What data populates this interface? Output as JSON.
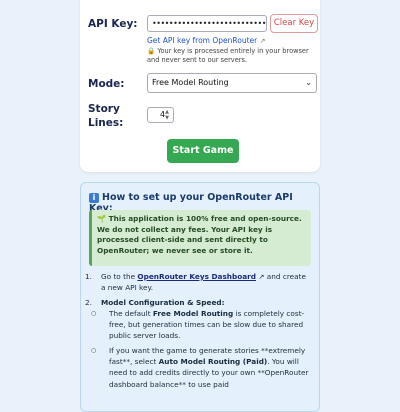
{
  "form": {
    "api_key_label": "API Key:",
    "api_key_masked": "••••••••••••••••••••••••••••••••••••••",
    "clear_key_label": "Clear Key",
    "get_key_link": "Get API key from OpenRouter",
    "privacy_note": "Your key is processed entirely in your browser and never sent to our servers.",
    "mode_label": "Mode:",
    "mode_selected": "Free Model Routing",
    "story_lines_label_1": "Story",
    "story_lines_label_2": "Lines:",
    "story_lines_value": "4",
    "start_button": "Start Game"
  },
  "info": {
    "title": "How to set up your OpenRouter API Key:",
    "green_note": "This application is 100% free and open-source. We do not collect any fees. Your API key is processed client-side and sent directly to OpenRouter; we never see or store it.",
    "step1_prefix": "Go to the",
    "step1_link": "OpenRouter Keys Dashboard",
    "step1_suffix": "and create a new API key.",
    "step2_title": "Model Configuration & Speed:",
    "bullet1_prefix": "The default",
    "bullet1_bold": "Free Model Routing",
    "bullet1_suffix": "is completely cost-free, but generation times can be slow due to shared public server loads.",
    "bullet2_prefix": "If you want the game to generate stories **extremely fast**, select",
    "bullet2_bold": "Auto Model Routing (Paid)",
    "bullet2_suffix": ". You will need to add credits directly to your own **OpenRouter dashboard balance** to use paid"
  }
}
